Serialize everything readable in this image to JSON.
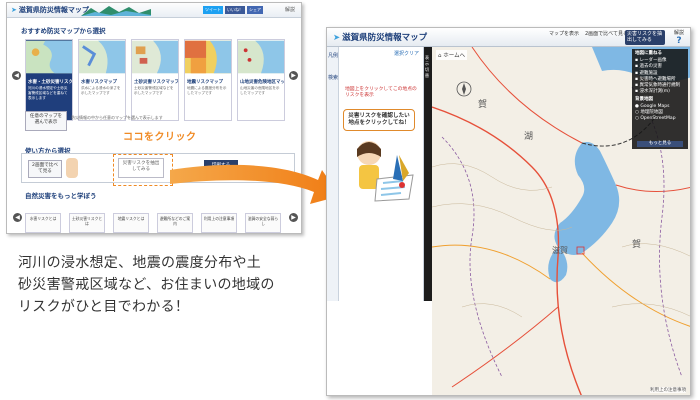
{
  "left": {
    "app_title": "滋賀県防災情報マップ",
    "social": [
      "ツイート",
      "いいね！",
      "シェア"
    ],
    "help": "解説",
    "recommended_title": "おすすめ防災マップから選択",
    "cards": [
      {
        "title": "水害・土砂災害リスクマップ",
        "desc": "河川の浸水想定や土砂災害警戒区域などを重ねて表示します"
      },
      {
        "title": "水害リスクマップ",
        "desc": "洪水による浸水の深さを示したマップです"
      },
      {
        "title": "土砂災害リスクマップ",
        "desc": "土砂災害警戒区域などを示したマップです"
      },
      {
        "title": "地震リスクマップ",
        "desc": "地震による震度分布を示したマップです"
      },
      {
        "title": "山地災害危険地区マップ",
        "desc": "山地災害の危険地区を示したマップです"
      }
    ],
    "optional_button": "任意のマップを選んで表示",
    "optional_desc": "防災情報の中から任意のマップを選んで表示します",
    "usage_title": "使い方から選択",
    "usage_buttons": [
      "2画面で比べて見る",
      "災害リスクを抽出してみる",
      "印刷する"
    ],
    "callout": "ココをクリック",
    "learn_title": "自然災害をもっと学ぼう",
    "learn_items": [
      "水害リスクとは",
      "土砂災害リスクとは",
      "地震リスクとは",
      "避難所などのご案内",
      "利用上の注意事項",
      "滋賀の安全な暮らし"
    ]
  },
  "right": {
    "app_title": "滋賀県防災情報マップ",
    "header_buttons": [
      "マップを表示",
      "2画面で比べて見る",
      "災害リスクを抽出してみる"
    ],
    "help": "解説",
    "tabs": [
      "凡例",
      "検索"
    ],
    "clear": "選択クリア",
    "hint": "地図上をクリックしてこの地点のリスクを表示",
    "bubble": "災害リスクを確認したい地点をクリックしてね！",
    "home": "ホームへ",
    "strip_label": "表示切替",
    "layers": {
      "header": "地図に重ねる",
      "items": [
        "レーダー画像",
        "過去の災害",
        "避難施設",
        "災害時へ避難場所",
        "異常気象時通行規制",
        "浸水深計測(m)"
      ],
      "base_header": "背景地図",
      "base_items": [
        "Google Maps",
        "地理院地図",
        "OpenStreetMap"
      ],
      "bottom": "もっと見る"
    },
    "map_labels": [
      "賀",
      "賀",
      "湖",
      "滋賀"
    ],
    "footnote": "利用上の注意事項"
  },
  "caption": {
    "line1": "河川の浸水想定、地震の震度分布や土",
    "line2": "砂災害警戒区域など、お住まいの地域の",
    "line3": "リスクがひと目でわかる！"
  },
  "colors": {
    "brand_blue": "#1d3f7a",
    "accent_orange": "#f08a24",
    "lake_blue": "#7fb8e4"
  }
}
